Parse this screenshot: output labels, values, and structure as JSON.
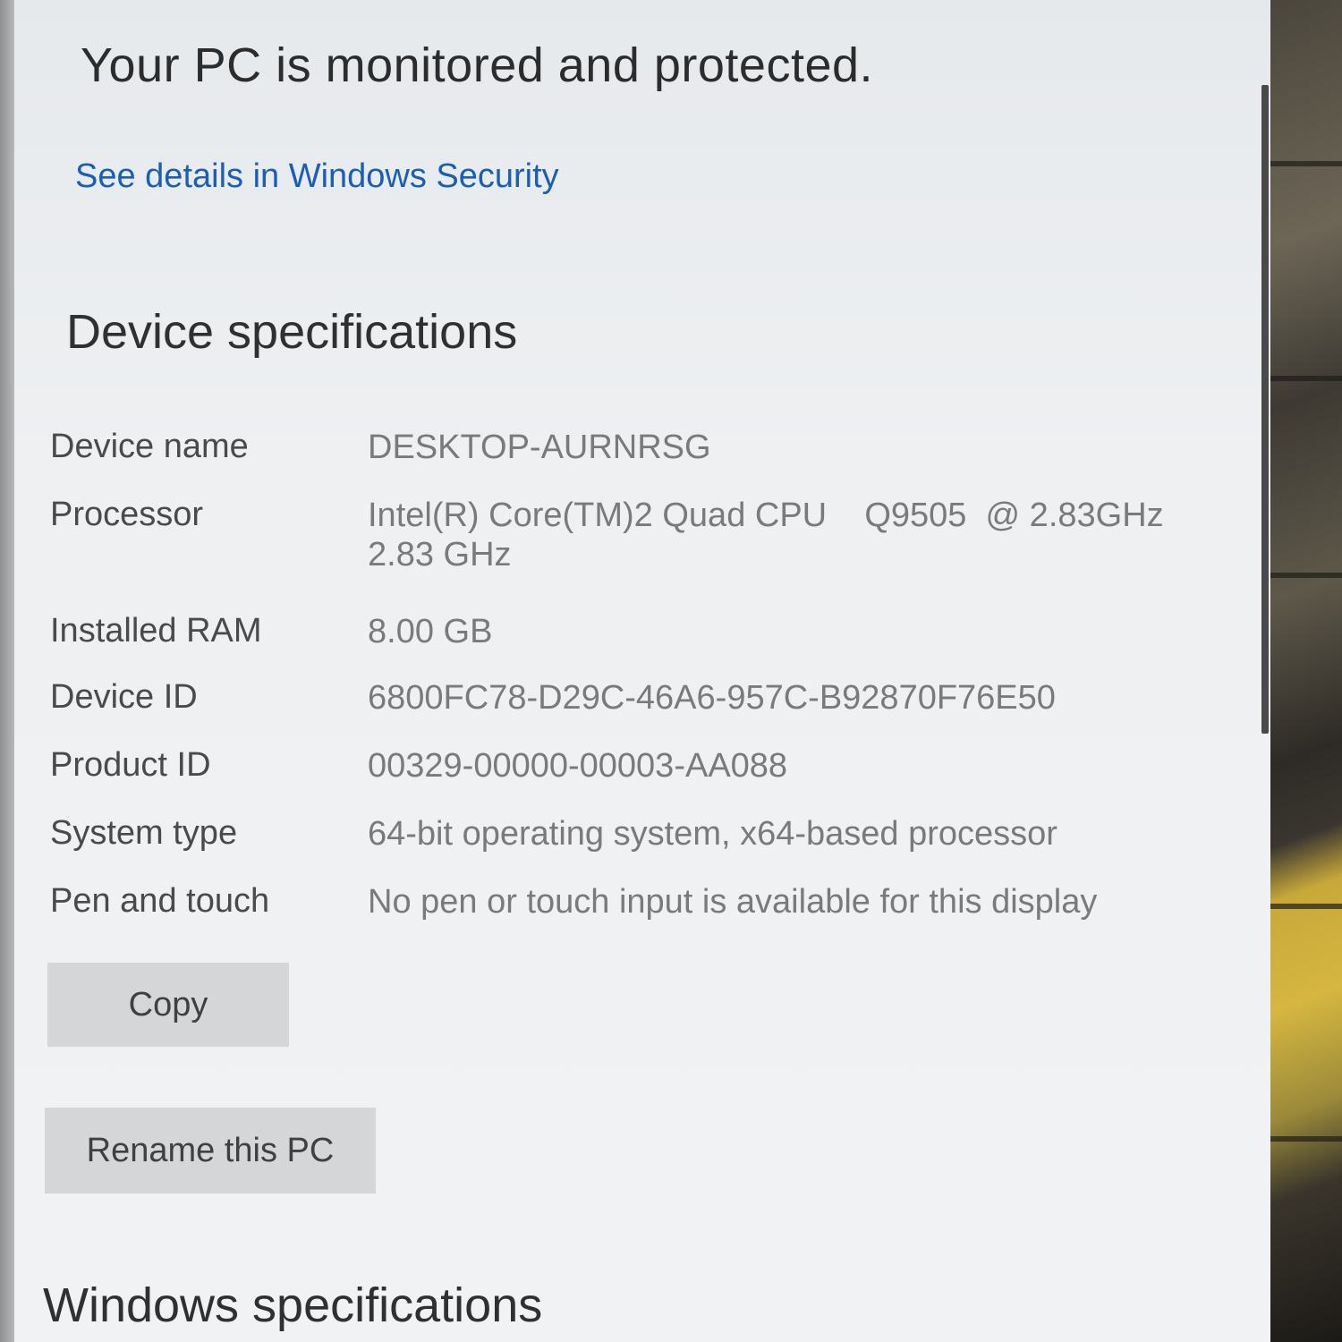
{
  "security": {
    "status": "Your PC is monitored and protected.",
    "link": "See details in Windows Security"
  },
  "device_specs": {
    "heading": "Device specifications",
    "rows": [
      {
        "label": "Device name",
        "value": "DESKTOP-AURNRSG"
      },
      {
        "label": "Processor",
        "value": "Intel(R) Core(TM)2 Quad CPU    Q9505  @ 2.83GHz",
        "value2": "2.83 GHz"
      },
      {
        "label": "Installed RAM",
        "value": "8.00 GB"
      },
      {
        "label": "Device ID",
        "value": "6800FC78-D29C-46A6-957C-B92870F76E50"
      },
      {
        "label": "Product ID",
        "value": "00329-00000-00003-AA088"
      },
      {
        "label": "System type",
        "value": "64-bit operating system, x64-based processor"
      },
      {
        "label": "Pen and touch",
        "value": "No pen or touch input is available for this display"
      }
    ],
    "copy_button": "Copy",
    "rename_button": "Rename this PC"
  },
  "windows_specs": {
    "heading": "Windows specifications"
  },
  "colors": {
    "link": "#1a5fb4",
    "background": "#eef0f2",
    "button": "#d4d6d8"
  }
}
